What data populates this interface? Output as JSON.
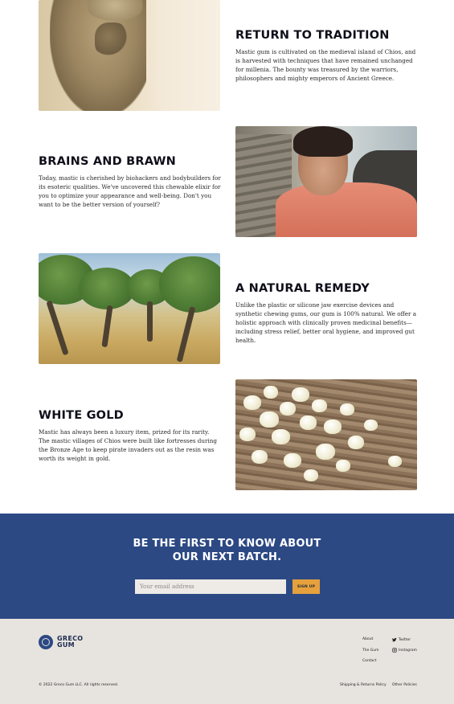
{
  "features": [
    {
      "title": "RETURN TO TRADITION",
      "body": "Mastic gum is cultivated on the medieval island of Chios, and is harvested with techniques that have remained unchanged for millenia. The bounty was treasured by the warriors, philosophers and mighty emperors of Ancient Greece."
    },
    {
      "title": "BRAINS AND BRAWN",
      "body": "Today, mastic is cherished by biohackers and bodybuilders for its esoteric qualities. We've uncovered this chewable elixir for you to optimize your appearance and well-being. Don't you want to be the better version of yourself?"
    },
    {
      "title": "A NATURAL REMEDY",
      "body": "Unlike the plastic or silicone jaw exercise devices and synthetic chewing gums, our gum is 100% natural. We offer a holistic approach with clinically proven medicinal benefits—including stress relief, better oral hygiene, and improved gut health."
    },
    {
      "title": "WHITE GOLD",
      "body": "Mastic has always been a luxury item, prized for its rarity. The mastic villages of Chios were built like fortresses during the Bronze Age to keep pirate invaders out as the resin was worth its weight in gold."
    }
  ],
  "newsletter": {
    "heading_line1": "BE THE FIRST TO KNOW ABOUT",
    "heading_line2": "OUR NEXT BATCH.",
    "email_placeholder": "Your email address",
    "signup_label": "SIGN UP"
  },
  "footer": {
    "logo_line1": "GRECO",
    "logo_line2": "GUM",
    "links": [
      "About",
      "The Gum",
      "Contact"
    ],
    "social": [
      {
        "label": "Twitter",
        "icon": "twitter-icon"
      },
      {
        "label": "Instagram",
        "icon": "instagram-icon"
      }
    ],
    "copyright": "© 2022 Greco Gum LLC. All rights reserved.",
    "legal_shipping": "Shipping & Returns Policy",
    "legal_other": "Other Policies"
  },
  "colors": {
    "navy": "#2c4984",
    "accent": "#e6a13c",
    "footer_bg": "#e7e4df"
  }
}
